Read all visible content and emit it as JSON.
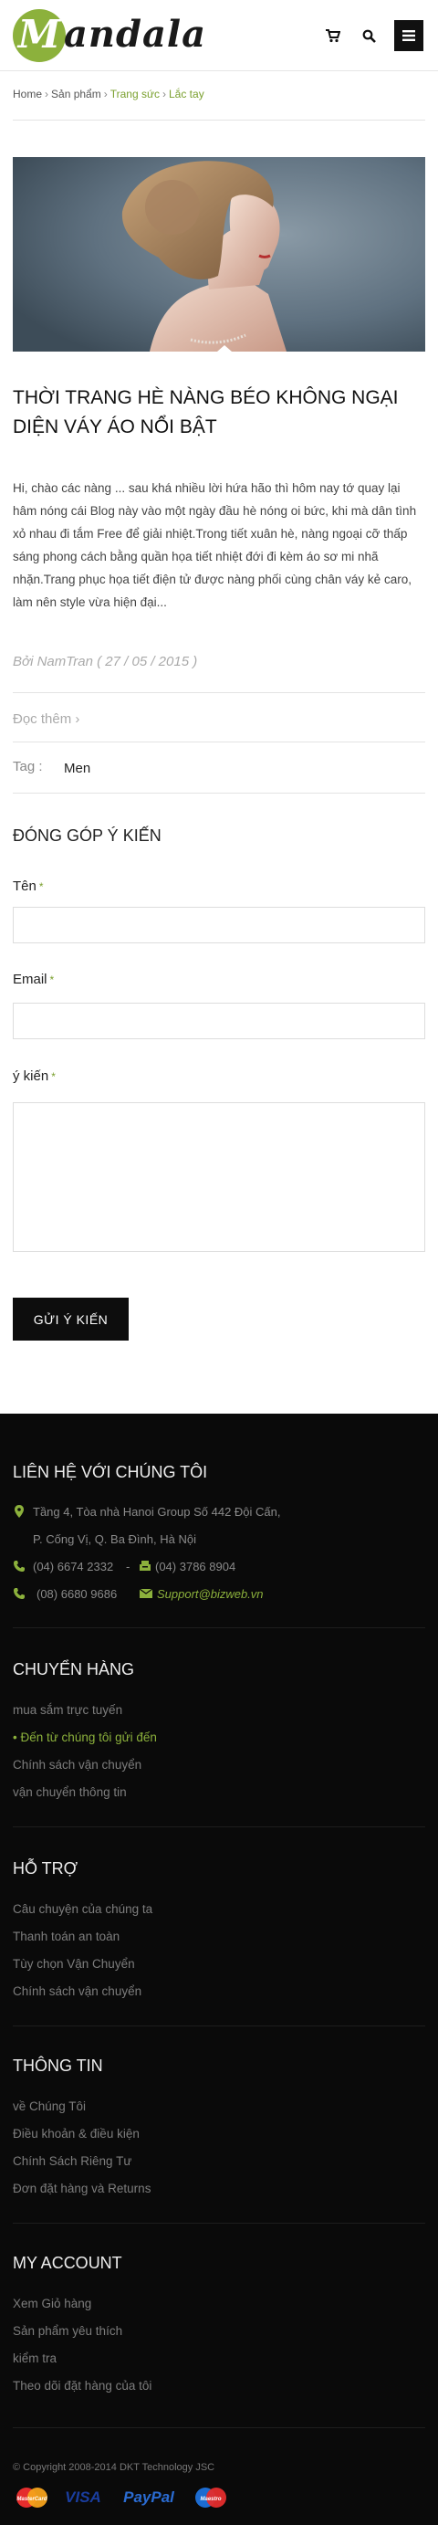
{
  "header": {
    "logo_letter": "M",
    "logo_text": "andala",
    "icons": [
      "cart-icon",
      "search-icon",
      "menu-icon"
    ]
  },
  "breadcrumb": [
    "Home",
    "Sản phẩm",
    "Trang sức",
    "Lắc tay"
  ],
  "article": {
    "title": "THỜI TRANG HÈ NÀNG BÉO KHÔNG NGẠI DIỆN VÁY ÁO NỔI BẬT",
    "excerpt": "Hi, chào các nàng ... sau khá nhiều lời hứa hão thì hôm nay tớ quay lại hâm nóng cái Blog này vào một ngày đầu hè nóng oi bức, khi mà dân tình xỏ nhau đi tắm Free để giải nhiệt.Trong tiết xuân hè, nàng ngoại cỡ thấp sáng phong cách bằng quần họa tiết nhiệt đới đi kèm áo sơ mi nhã nhặn.Trang phục họa tiết điện tử được nàng phối cùng chân váy kẻ caro, làm nên style vừa hiện đại...",
    "byline": "Bởi NamTran ( 27 / 05 / 2015 )",
    "read_more": "Đọc thêm",
    "tag_label": "Tag :",
    "tag_value": "Men"
  },
  "form": {
    "title": "ĐÓNG GÓP Ý KIẾN",
    "name_label": "Tên",
    "email_label": "Email",
    "comment_label": "ý kiến",
    "required_mark": "*",
    "submit_label": "GỬI Ý KIẾN"
  },
  "footer": {
    "contact": {
      "title": "LIÊN HỆ VỚI CHÚNG TÔI",
      "address_line1": "Tầng 4, Tòa nhà Hanoi Group  Số 442 Đội Cấn,",
      "address_line2": "P. Cống Vị, Q. Ba Đình, Hà Nội",
      "phone1": "(04) 6674 2332",
      "dash": "-",
      "phone2": "(04) 3786 8904",
      "phone3": "(08) 6680 9686",
      "email": "Support@bizweb.vn"
    },
    "shipping": {
      "title": "CHUYỂN HÀNG",
      "links": [
        "mua sắm trực tuyến",
        "Đến từ chúng tôi gửi đến",
        "Chính sách vận chuyển",
        "vận chuyển thông tin"
      ]
    },
    "support": {
      "title": "HỖ TRỢ",
      "links": [
        "Câu chuyện của chúng ta",
        "Thanh toán an toàn",
        "Tùy chọn Vận Chuyển",
        "Chính sách vận chuyển"
      ]
    },
    "info": {
      "title": "THÔNG TIN",
      "links": [
        "về Chúng Tôi",
        "Điều khoản & điều kiện",
        "Chính Sách Riêng Tư",
        "Đơn đặt hàng và Returns"
      ]
    },
    "account": {
      "title": "MY ACCOUNT",
      "links": [
        "Xem Giỏ hàng",
        "Sản phẩm yêu thích",
        "kiểm tra",
        "Theo dõi đặt hàng của tôi"
      ]
    },
    "copyright": "© Copyright 2008-2014 DKT Technology JSC",
    "payments": [
      "MasterCard",
      "VISA",
      "PayPal",
      "Maestro"
    ]
  },
  "colors": {
    "accent": "#8cb13c",
    "footer_bg": "#0a0a0a"
  }
}
